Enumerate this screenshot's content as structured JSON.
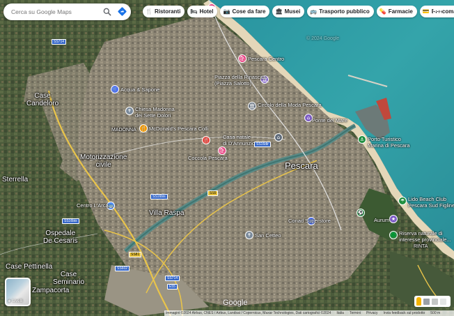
{
  "search": {
    "placeholder": "Cerca su Google Maps"
  },
  "chips": [
    {
      "icon": "🍴",
      "icon_name": "restaurant-icon",
      "label": "Ristoranti"
    },
    {
      "icon": "🛏",
      "icon_name": "hotel-icon",
      "label": "Hotel"
    },
    {
      "icon": "📷",
      "icon_name": "camera-icon",
      "label": "Cose da fare"
    },
    {
      "icon": "🏛",
      "icon_name": "museum-icon",
      "label": "Musei"
    },
    {
      "icon": "🚌",
      "icon_name": "transit-icon",
      "label": "Trasporto pubblico"
    },
    {
      "icon": "💊",
      "icon_name": "pharmacy-icon",
      "label": "Farmacie"
    },
    {
      "icon": "💳",
      "icon_name": "atm-icon",
      "label": "Bancomat"
    }
  ],
  "map_labels": {
    "city": "Pescara",
    "case_candeloro": "Case\nCandeloro",
    "sterpeta": "Sterrella",
    "motorizzazione": "Motorizzazione\ncivile",
    "madonna": "MADONNA",
    "villa_raspa": "Villa Raspa",
    "ospedale": "Ospedale\nDe Cesaris",
    "case_pettinella": "Case Pettinella",
    "case_seminario": "Case\nSeminario",
    "zampacorta": "Zampacorta",
    "rinta": "RINTA",
    "copyright": "© 2024 Google",
    "centro_arca": "Centro L'Arca"
  },
  "pois": {
    "acqua_sapone": "Acqua & Sapone",
    "chiesa_madonna": "Chiesa Madonna\ndei Sette Dolori",
    "mcdonalds": "McDonald's Pescara Colli",
    "piazza_salotto": "Piazza della Rinascita\n(Piazza Salotto)",
    "pescara_centro": "Pescara Centro",
    "coccola": "Coccola Pescara",
    "circolo_moda": "Circolo della Moda Pescara",
    "dannunzio": "Casa natale\ndi D'Annunzio",
    "ponte_mare": "Ponte del Mare",
    "porto_turistico": "Porto Turistico\nMarina di Pescara",
    "lido_beach": "Lido Beach Club\nPescara Sud Figline",
    "aurum": "Aurum",
    "riserva": "Riserva naturale di\ninteresse provinciale...",
    "san_cetteo": "San Cetteo",
    "conad": "Conad Superstore"
  },
  "roads": [
    "SS714",
    "SS16dir",
    "SS16bis",
    "SS81",
    "SS602",
    "SS5",
    "E55",
    "SS16"
  ],
  "layers": {
    "label": "Livelli"
  },
  "logo": "Google",
  "attribution": {
    "imagery": "Immagini ©2024 Airbus, CNES / Airbus, Landsat / Copernicus, Maxar Technologies, Dati cartografici ©2024",
    "country": "Italia",
    "terms": "Termini",
    "privacy": "Privacy",
    "feedback": "Invia feedback sul prodotto",
    "scale": "500 m"
  },
  "colors": {
    "sea": "#2f9aa6",
    "sea_deep": "#3ba8a6",
    "beach": "#e4d7b9",
    "urban": "#8a8272",
    "green": "#4a5b3c",
    "river": "#5a8a86",
    "highway": "#e9c44a"
  }
}
